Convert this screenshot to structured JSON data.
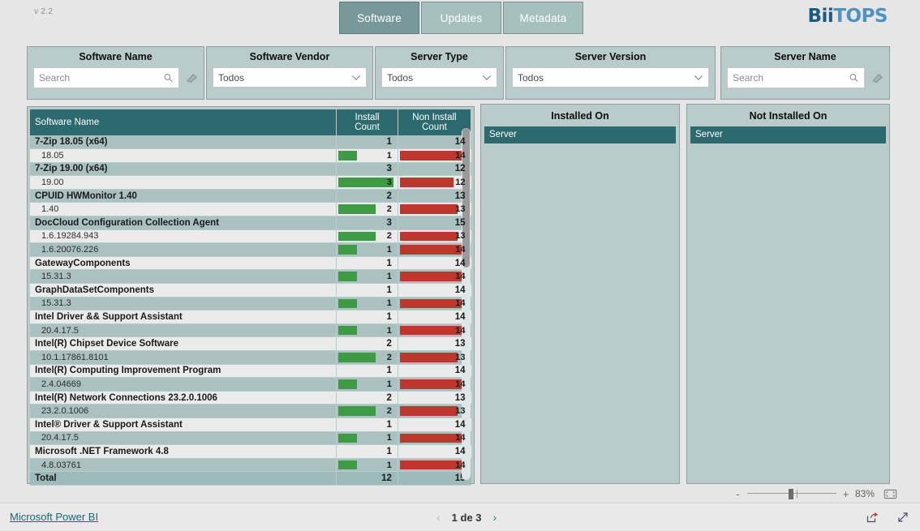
{
  "header": {
    "version": "v 2.2",
    "logo_dark": "Bii",
    "logo_light": "TOPS",
    "tabs": [
      {
        "label": "Software",
        "active": true
      },
      {
        "label": "Updates",
        "active": false
      },
      {
        "label": "Metadata",
        "active": false
      }
    ]
  },
  "filters": [
    {
      "title": "Software Name",
      "type": "search",
      "value": "",
      "placeholder": "Search",
      "has_eraser": true
    },
    {
      "title": "Software Vendor",
      "type": "dropdown",
      "value": "Todos"
    },
    {
      "title": "Server Type",
      "type": "dropdown",
      "value": "Todos"
    },
    {
      "title": "Server Version",
      "type": "dropdown",
      "value": "Todos"
    },
    {
      "title": "Server Name",
      "type": "search",
      "value": "",
      "placeholder": "Search",
      "has_eraser": true
    }
  ],
  "table": {
    "columns": [
      "Software Name",
      "Install Count",
      "Non Install Count"
    ],
    "max_install": 3,
    "max_non_install": 15,
    "rows": [
      {
        "type": "group",
        "name": "7-Zip 18.05 (x64)",
        "install": 1,
        "non_install": 14
      },
      {
        "type": "child",
        "name": "18.05",
        "install": 1,
        "non_install": 14
      },
      {
        "type": "group",
        "name": "7-Zip 19.00 (x64)",
        "install": 3,
        "non_install": 12
      },
      {
        "type": "child",
        "name": "19.00",
        "install": 3,
        "non_install": 12
      },
      {
        "type": "group",
        "name": "CPUID HWMonitor 1.40",
        "install": 2,
        "non_install": 13
      },
      {
        "type": "child",
        "name": "1.40",
        "install": 2,
        "non_install": 13
      },
      {
        "type": "group",
        "name": "DocCloud Configuration Collection Agent",
        "install": 3,
        "non_install": 15
      },
      {
        "type": "child",
        "name": "1.6.19284.943",
        "install": 2,
        "non_install": 13
      },
      {
        "type": "child",
        "name": "1.6.20076.226",
        "install": 1,
        "non_install": 14
      },
      {
        "type": "group",
        "name": "GatewayComponents",
        "install": 1,
        "non_install": 14
      },
      {
        "type": "child",
        "name": "15.31.3",
        "install": 1,
        "non_install": 14
      },
      {
        "type": "group",
        "name": "GraphDataSetComponents",
        "install": 1,
        "non_install": 14
      },
      {
        "type": "child",
        "name": "15.31.3",
        "install": 1,
        "non_install": 14
      },
      {
        "type": "group",
        "name": "Intel Driver && Support Assistant",
        "install": 1,
        "non_install": 14
      },
      {
        "type": "child",
        "name": "20.4.17.5",
        "install": 1,
        "non_install": 14
      },
      {
        "type": "group",
        "name": "Intel(R) Chipset Device Software",
        "install": 2,
        "non_install": 13
      },
      {
        "type": "child",
        "name": "10.1.17861.8101",
        "install": 2,
        "non_install": 13
      },
      {
        "type": "group",
        "name": "Intel(R) Computing Improvement Program",
        "install": 1,
        "non_install": 14
      },
      {
        "type": "child",
        "name": "2.4.04669",
        "install": 1,
        "non_install": 14
      },
      {
        "type": "group",
        "name": "Intel(R) Network Connections 23.2.0.1006",
        "install": 2,
        "non_install": 13
      },
      {
        "type": "child",
        "name": "23.2.0.1006",
        "install": 2,
        "non_install": 13
      },
      {
        "type": "group",
        "name": "Intel® Driver & Support Assistant",
        "install": 1,
        "non_install": 14
      },
      {
        "type": "child",
        "name": "20.4.17.5",
        "install": 1,
        "non_install": 14
      },
      {
        "type": "group",
        "name": "Microsoft .NET Framework 4.8",
        "install": 1,
        "non_install": 14
      },
      {
        "type": "child",
        "name": "4.8.03761",
        "install": 1,
        "non_install": 14
      }
    ],
    "total": {
      "name": "Total",
      "install": 12,
      "non_install": 15
    }
  },
  "installed_panel": {
    "title": "Installed On",
    "column": "Server",
    "rows": []
  },
  "not_installed_panel": {
    "title": "Not Installed On",
    "column": "Server",
    "rows": []
  },
  "zoom_bar": {
    "minus": "-",
    "plus": "+",
    "percent": "83%"
  },
  "footer": {
    "brand": "Microsoft Power BI",
    "page_label": "1 de 3",
    "prev": "‹",
    "next": "›"
  },
  "colors": {
    "accent_teal": "#2c6a70",
    "panel": "#b9cbca",
    "bar_green": "#3d9c43",
    "bar_red": "#c0352c",
    "logo_dark": "#1d5a82",
    "logo_light": "#4e93bf"
  }
}
